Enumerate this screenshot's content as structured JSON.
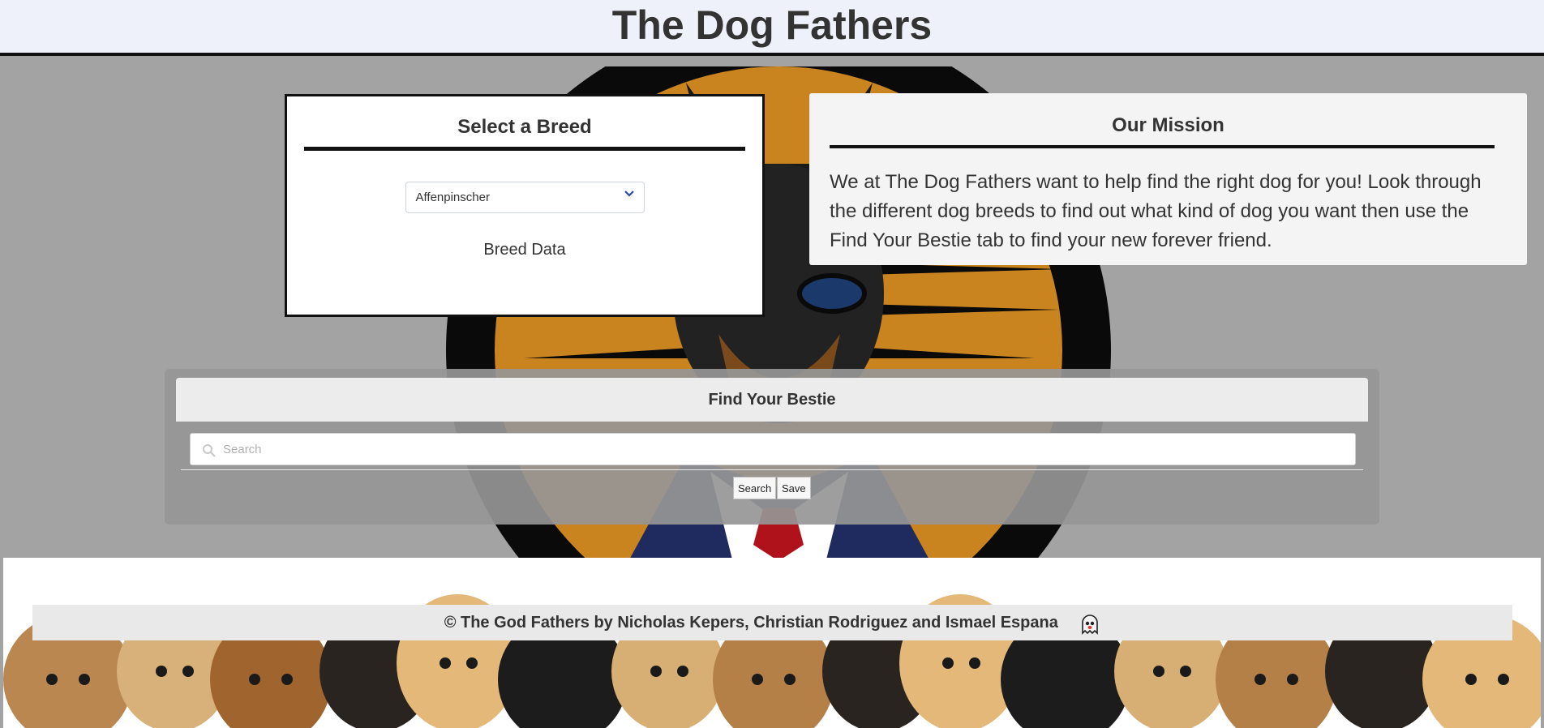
{
  "header": {
    "title": "The Dog Fathers"
  },
  "breed_panel": {
    "title": "Select a Breed",
    "selected_breed": "Affenpinscher",
    "data_label": "Breed Data"
  },
  "mission_panel": {
    "title": "Our Mission",
    "text": "We at The Dog Fathers want to help find the right dog for you! Look through the different dog breeds to find out what kind of dog you want then use the Find Your Bestie tab to find your new forever friend."
  },
  "bestie_panel": {
    "title": "Find Your Bestie",
    "search_placeholder": "Search",
    "search_value": "",
    "search_button": "Search",
    "save_button": "Save"
  },
  "footer": {
    "credit": "© The God Fathers by Nicholas Kepers, Christian Rodriguez and Ismael Espana",
    "icon": "ghost-icon"
  },
  "colors": {
    "header_bg": "#eef1f9",
    "page_bg": "#a3a3a3",
    "mascot_orange": "#c98420",
    "suit_blue": "#1f2a5e",
    "tie_red": "#b0121b"
  }
}
